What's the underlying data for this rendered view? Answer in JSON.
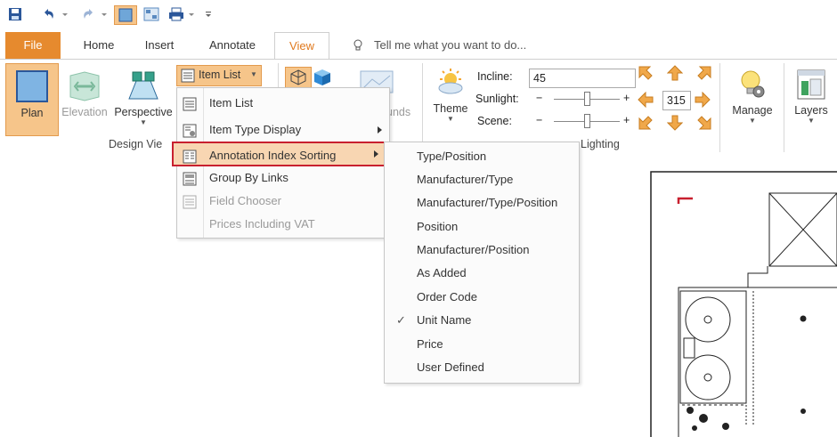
{
  "tabs": {
    "file": "File",
    "home": "Home",
    "insert": "Insert",
    "annotate": "Annotate",
    "view": "View",
    "tell_me": "Tell me what you want to do..."
  },
  "ribbon": {
    "plan": "Plan",
    "elevation": "Elevation",
    "perspective": "Perspective",
    "item_list": "Item List",
    "design_view_group": "Design Vie",
    "bounds_partial": "unds",
    "theme": "Theme",
    "incline_label": "Incline:",
    "incline_value": "45",
    "sunlight_label": "Sunlight:",
    "scene_label": "Scene:",
    "minus": "−",
    "plus": "+",
    "rotation_value": "315",
    "lighting_group": "Lighting",
    "manage": "Manage",
    "layers": "Layers",
    "sunlight_level": 0.5,
    "scene_level": 0.5
  },
  "item_list_menu": {
    "items": [
      {
        "label": "Item List",
        "enabled": true
      },
      {
        "label": "Item Type Display",
        "enabled": true,
        "submenu": true
      },
      {
        "label": "Annotation Index Sorting",
        "enabled": true,
        "submenu": true,
        "highlighted": true
      },
      {
        "label": "Group By Links",
        "enabled": true
      },
      {
        "label": "Field Chooser",
        "enabled": false
      },
      {
        "label": "Prices Including VAT",
        "enabled": false
      }
    ]
  },
  "sorting_submenu": {
    "items": [
      {
        "label": "Type/Position",
        "checked": false
      },
      {
        "label": "Manufacturer/Type",
        "checked": false
      },
      {
        "label": "Manufacturer/Type/Position",
        "checked": false
      },
      {
        "label": "Position",
        "checked": false
      },
      {
        "label": "Manufacturer/Position",
        "checked": false
      },
      {
        "label": "As Added",
        "checked": false
      },
      {
        "label": "Order Code",
        "checked": false
      },
      {
        "label": "Unit Name",
        "checked": true
      },
      {
        "label": "Price",
        "checked": false
      },
      {
        "label": "User Defined",
        "checked": false
      }
    ],
    "check_glyph": "✓"
  },
  "colors": {
    "accent_orange": "#e68a2e",
    "highlight_border": "#c8202f",
    "active_button": "#f6c58a",
    "ribbon_blue": "#2b579a"
  }
}
